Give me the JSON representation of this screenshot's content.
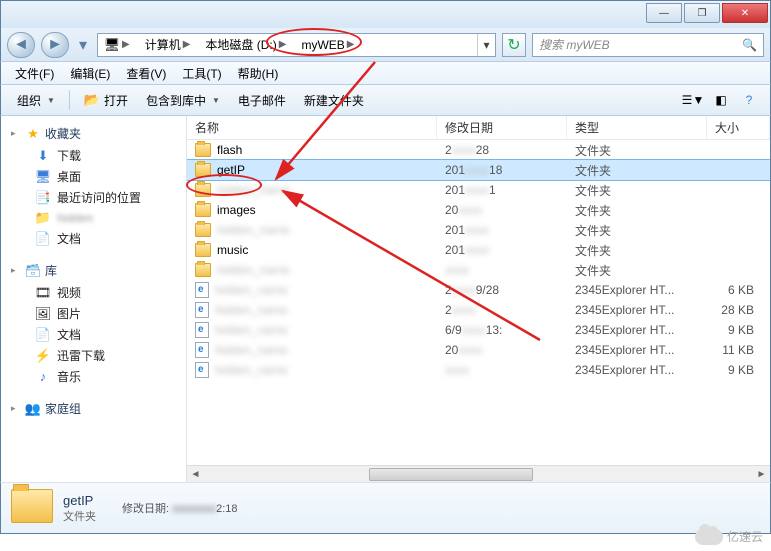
{
  "window": {
    "min_icon": "—",
    "max_icon": "❐",
    "close_icon": "✕"
  },
  "breadcrumb": {
    "segments": [
      "计算机",
      "本地磁盘 (D:)",
      "myWEB"
    ]
  },
  "search": {
    "placeholder": "搜索 myWEB"
  },
  "menubar": {
    "file": "文件(F)",
    "edit": "编辑(E)",
    "view": "查看(V)",
    "tools": "工具(T)",
    "help": "帮助(H)"
  },
  "toolbar": {
    "organize": "组织",
    "open": "打开",
    "include": "包含到库中",
    "email": "电子邮件",
    "newfolder": "新建文件夹"
  },
  "sidebar": {
    "favorites": {
      "label": "收藏夹",
      "items": [
        "下载",
        "桌面",
        "最近访问的位置",
        "",
        "文档"
      ]
    },
    "libraries": {
      "label": "库",
      "items": [
        "视频",
        "图片",
        "文档",
        "迅雷下载",
        "音乐"
      ]
    },
    "homegroup": {
      "label": "家庭组"
    }
  },
  "columns": {
    "name": "名称",
    "date": "修改日期",
    "type": "类型",
    "size": "大小"
  },
  "rows": [
    {
      "icon": "folder",
      "name": "flash",
      "date": "2",
      "date_suffix": "28",
      "type": "文件夹",
      "size": "",
      "blur_name": false
    },
    {
      "icon": "folder",
      "name": "getIP",
      "date": "201",
      "date_suffix": "18",
      "type": "文件夹",
      "size": "",
      "blur_name": false,
      "selected": true
    },
    {
      "icon": "folder",
      "name": "",
      "date": "201",
      "date_suffix": "1",
      "type": "文件夹",
      "size": "",
      "blur_name": true
    },
    {
      "icon": "folder",
      "name": "images",
      "date": "20",
      "date_suffix": "",
      "type": "文件夹",
      "size": "",
      "blur_name": false
    },
    {
      "icon": "folder",
      "name": "",
      "date": "201",
      "date_suffix": "",
      "type": "文件夹",
      "size": "",
      "blur_name": true
    },
    {
      "icon": "folder",
      "name": "music",
      "date": "201",
      "date_suffix": "",
      "type": "文件夹",
      "size": "",
      "blur_name": false
    },
    {
      "icon": "folder",
      "name": "",
      "date": "",
      "date_suffix": "",
      "type": "文件夹",
      "size": "",
      "blur_name": true
    },
    {
      "icon": "html",
      "name": "",
      "date": "2",
      "date_suffix": "9/28",
      "type": "2345Explorer HT...",
      "size": "6 KB",
      "blur_name": true
    },
    {
      "icon": "html",
      "name": "",
      "date": "2",
      "date_suffix": "",
      "type": "2345Explorer HT...",
      "size": "28 KB",
      "blur_name": true
    },
    {
      "icon": "html",
      "name": "",
      "date": "6/9",
      "date_suffix": "13:",
      "type": "2345Explorer HT...",
      "size": "9 KB",
      "blur_name": true
    },
    {
      "icon": "html",
      "name": "",
      "date": "20",
      "date_suffix": "",
      "type": "2345Explorer HT...",
      "size": "11 KB",
      "blur_name": true
    },
    {
      "icon": "html",
      "name": "",
      "date": "",
      "date_suffix": "",
      "type": "2345Explorer HT...",
      "size": "9 KB",
      "blur_name": true
    }
  ],
  "details": {
    "name": "getIP",
    "type": "文件夹",
    "date_label": "修改日期:",
    "date_value": "2:18"
  },
  "watermark": "亿速云"
}
